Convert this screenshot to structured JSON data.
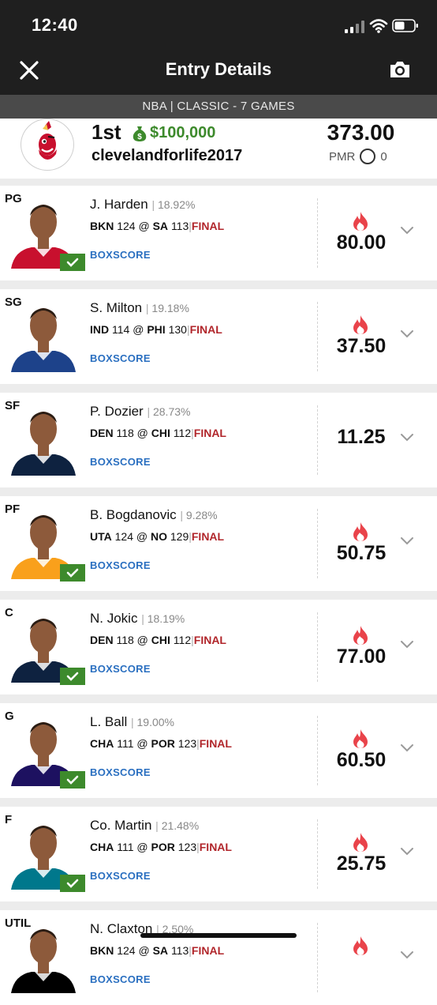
{
  "status_bar": {
    "time": "12:40"
  },
  "header": {
    "title": "Entry Details",
    "contest": "NBA | CLASSIC - 7 GAMES"
  },
  "entry": {
    "rank": "1st",
    "prize": "$100,000",
    "username": "clevelandforlife2017",
    "score": "373.00",
    "pmr_label": "PMR",
    "pmr_value": "0"
  },
  "players": [
    {
      "pos": "PG",
      "name": "J. Harden",
      "own": "18.92%",
      "away": "BKN",
      "away_score": "124",
      "home": "SA",
      "home_score": "113",
      "status": "FINAL",
      "boxscore": "BOXSCORE",
      "points": "80.00",
      "fire": true,
      "checked": true,
      "jersey": "#c8102e"
    },
    {
      "pos": "SG",
      "name": "S. Milton",
      "own": "19.18%",
      "away": "IND",
      "away_score": "114",
      "home": "PHI",
      "home_score": "130",
      "status": "FINAL",
      "boxscore": "BOXSCORE",
      "points": "37.50",
      "fire": true,
      "checked": false,
      "jersey": "#1d428a"
    },
    {
      "pos": "SF",
      "name": "P. Dozier",
      "own": "28.73%",
      "away": "DEN",
      "away_score": "118",
      "home": "CHI",
      "home_score": "112",
      "status": "FINAL",
      "boxscore": "BOXSCORE",
      "points": "11.25",
      "fire": false,
      "checked": false,
      "jersey": "#0e2240"
    },
    {
      "pos": "PF",
      "name": "B. Bogdanovic",
      "own": "9.28%",
      "away": "UTA",
      "away_score": "124",
      "home": "NO",
      "home_score": "129",
      "status": "FINAL",
      "boxscore": "BOXSCORE",
      "points": "50.75",
      "fire": true,
      "checked": true,
      "jersey": "#f9a01b"
    },
    {
      "pos": "C",
      "name": "N. Jokic",
      "own": "18.19%",
      "away": "DEN",
      "away_score": "118",
      "home": "CHI",
      "home_score": "112",
      "status": "FINAL",
      "boxscore": "BOXSCORE",
      "points": "77.00",
      "fire": true,
      "checked": true,
      "jersey": "#0e2240"
    },
    {
      "pos": "G",
      "name": "L. Ball",
      "own": "19.00%",
      "away": "CHA",
      "away_score": "111",
      "home": "POR",
      "home_score": "123",
      "status": "FINAL",
      "boxscore": "BOXSCORE",
      "points": "60.50",
      "fire": true,
      "checked": true,
      "jersey": "#1d1160"
    },
    {
      "pos": "F",
      "name": "Co. Martin",
      "own": "21.48%",
      "away": "CHA",
      "away_score": "111",
      "home": "POR",
      "home_score": "123",
      "status": "FINAL",
      "boxscore": "BOXSCORE",
      "points": "25.75",
      "fire": true,
      "checked": true,
      "jersey": "#00788c"
    },
    {
      "pos": "UTIL",
      "name": "N. Claxton",
      "own": "2.50%",
      "away": "BKN",
      "away_score": "124",
      "home": "SA",
      "home_score": "113",
      "status": "FINAL",
      "boxscore": "BOXSCORE",
      "points": "",
      "fire": true,
      "checked": false,
      "jersey": "#000000"
    }
  ],
  "colors": {
    "accent_green": "#3d8a2c",
    "final_red": "#b1262b",
    "fire_red": "#e9434a",
    "link_blue": "#2a6fc0"
  },
  "icons": {
    "close": "close-icon",
    "camera": "camera-icon",
    "money": "money-bag-icon",
    "fire": "fire-icon",
    "check": "check-icon",
    "chevron": "chevron-down-icon"
  }
}
